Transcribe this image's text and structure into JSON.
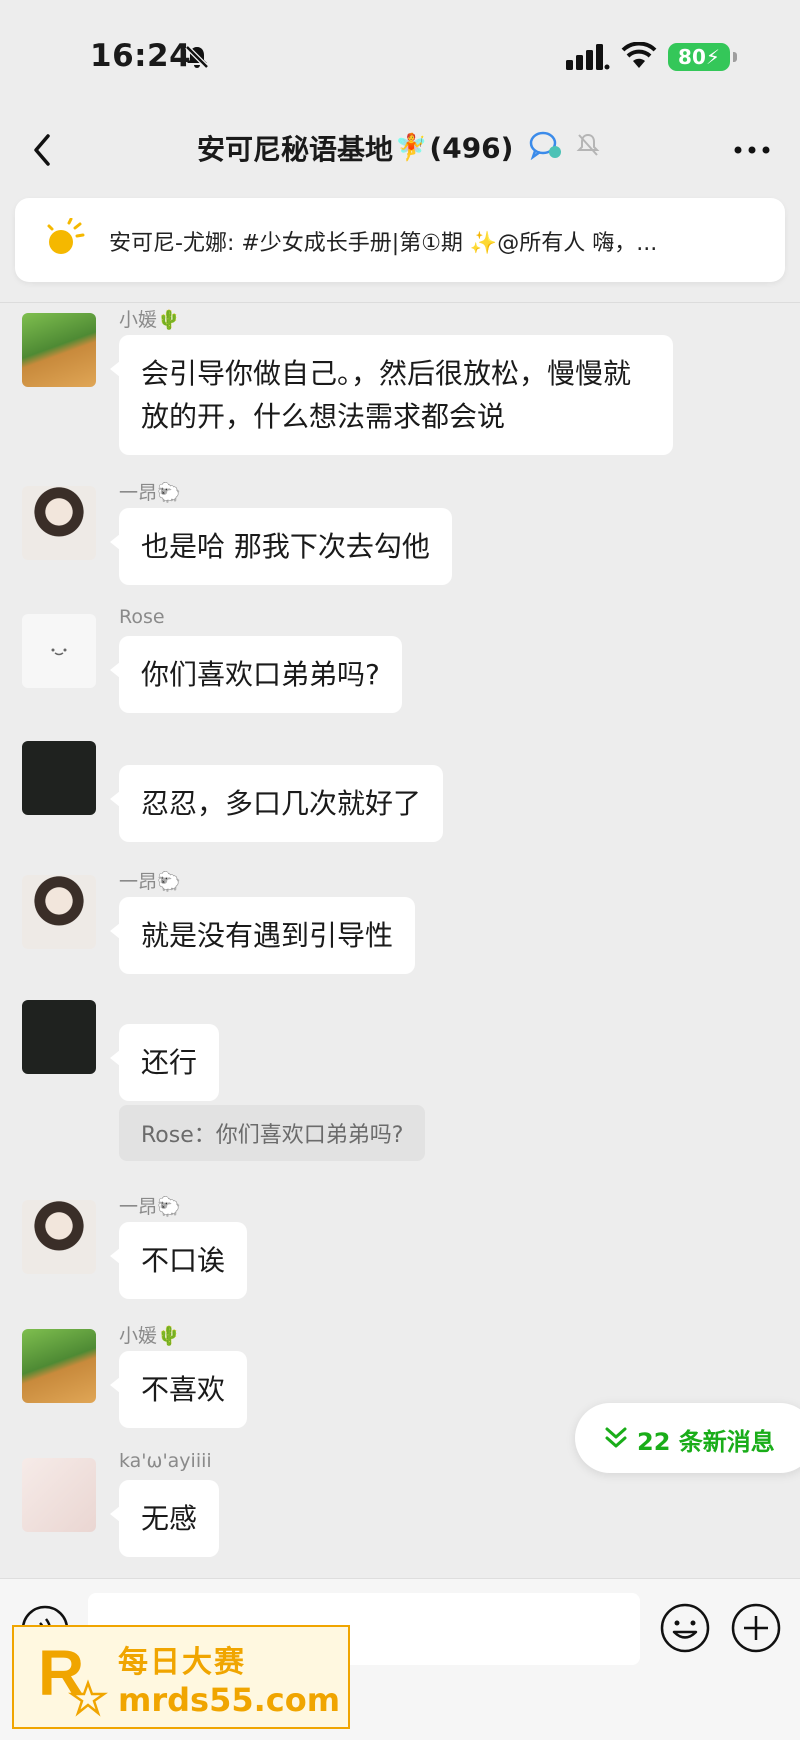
{
  "status_bar": {
    "time": "16:24",
    "battery": "80"
  },
  "nav": {
    "title": "安可尼秘语基地",
    "count": "(496)"
  },
  "pinned": {
    "text": "安可尼-尤娜: #少女成长手册|第①期 ✨@所有人  嗨，..."
  },
  "messages": [
    {
      "sender": "小媛🌵",
      "text": "会引导你做自己。，然后很放松，慢慢就放的开，什么想法需求都会说"
    },
    {
      "sender": "一昂🐑",
      "text": "也是哈 那我下次去勾他"
    },
    {
      "sender": "Rose",
      "text": "你们喜欢口弟弟吗?"
    },
    {
      "sender": "",
      "text": "忍忍，多口几次就好了"
    },
    {
      "sender": "一昂🐑",
      "text": "就是没有遇到引导性"
    },
    {
      "sender": "",
      "text": "还行",
      "quote": "Rose：你们喜欢口弟弟吗?"
    },
    {
      "sender": "一昂🐑",
      "text": "不口诶"
    },
    {
      "sender": "小媛🌵",
      "text": "不喜欢"
    },
    {
      "sender": "ka'ω'ayiiii",
      "text": "无感"
    }
  ],
  "new_messages": {
    "label": "22 条新消息"
  },
  "input": {
    "placeholder": ""
  },
  "watermark": {
    "line1": "每日大赛",
    "line2": "mrds55.com"
  },
  "colors": {
    "accent_green": "#1aad19",
    "battery_green": "#34c759",
    "watermark_orange": "#f0a500"
  }
}
